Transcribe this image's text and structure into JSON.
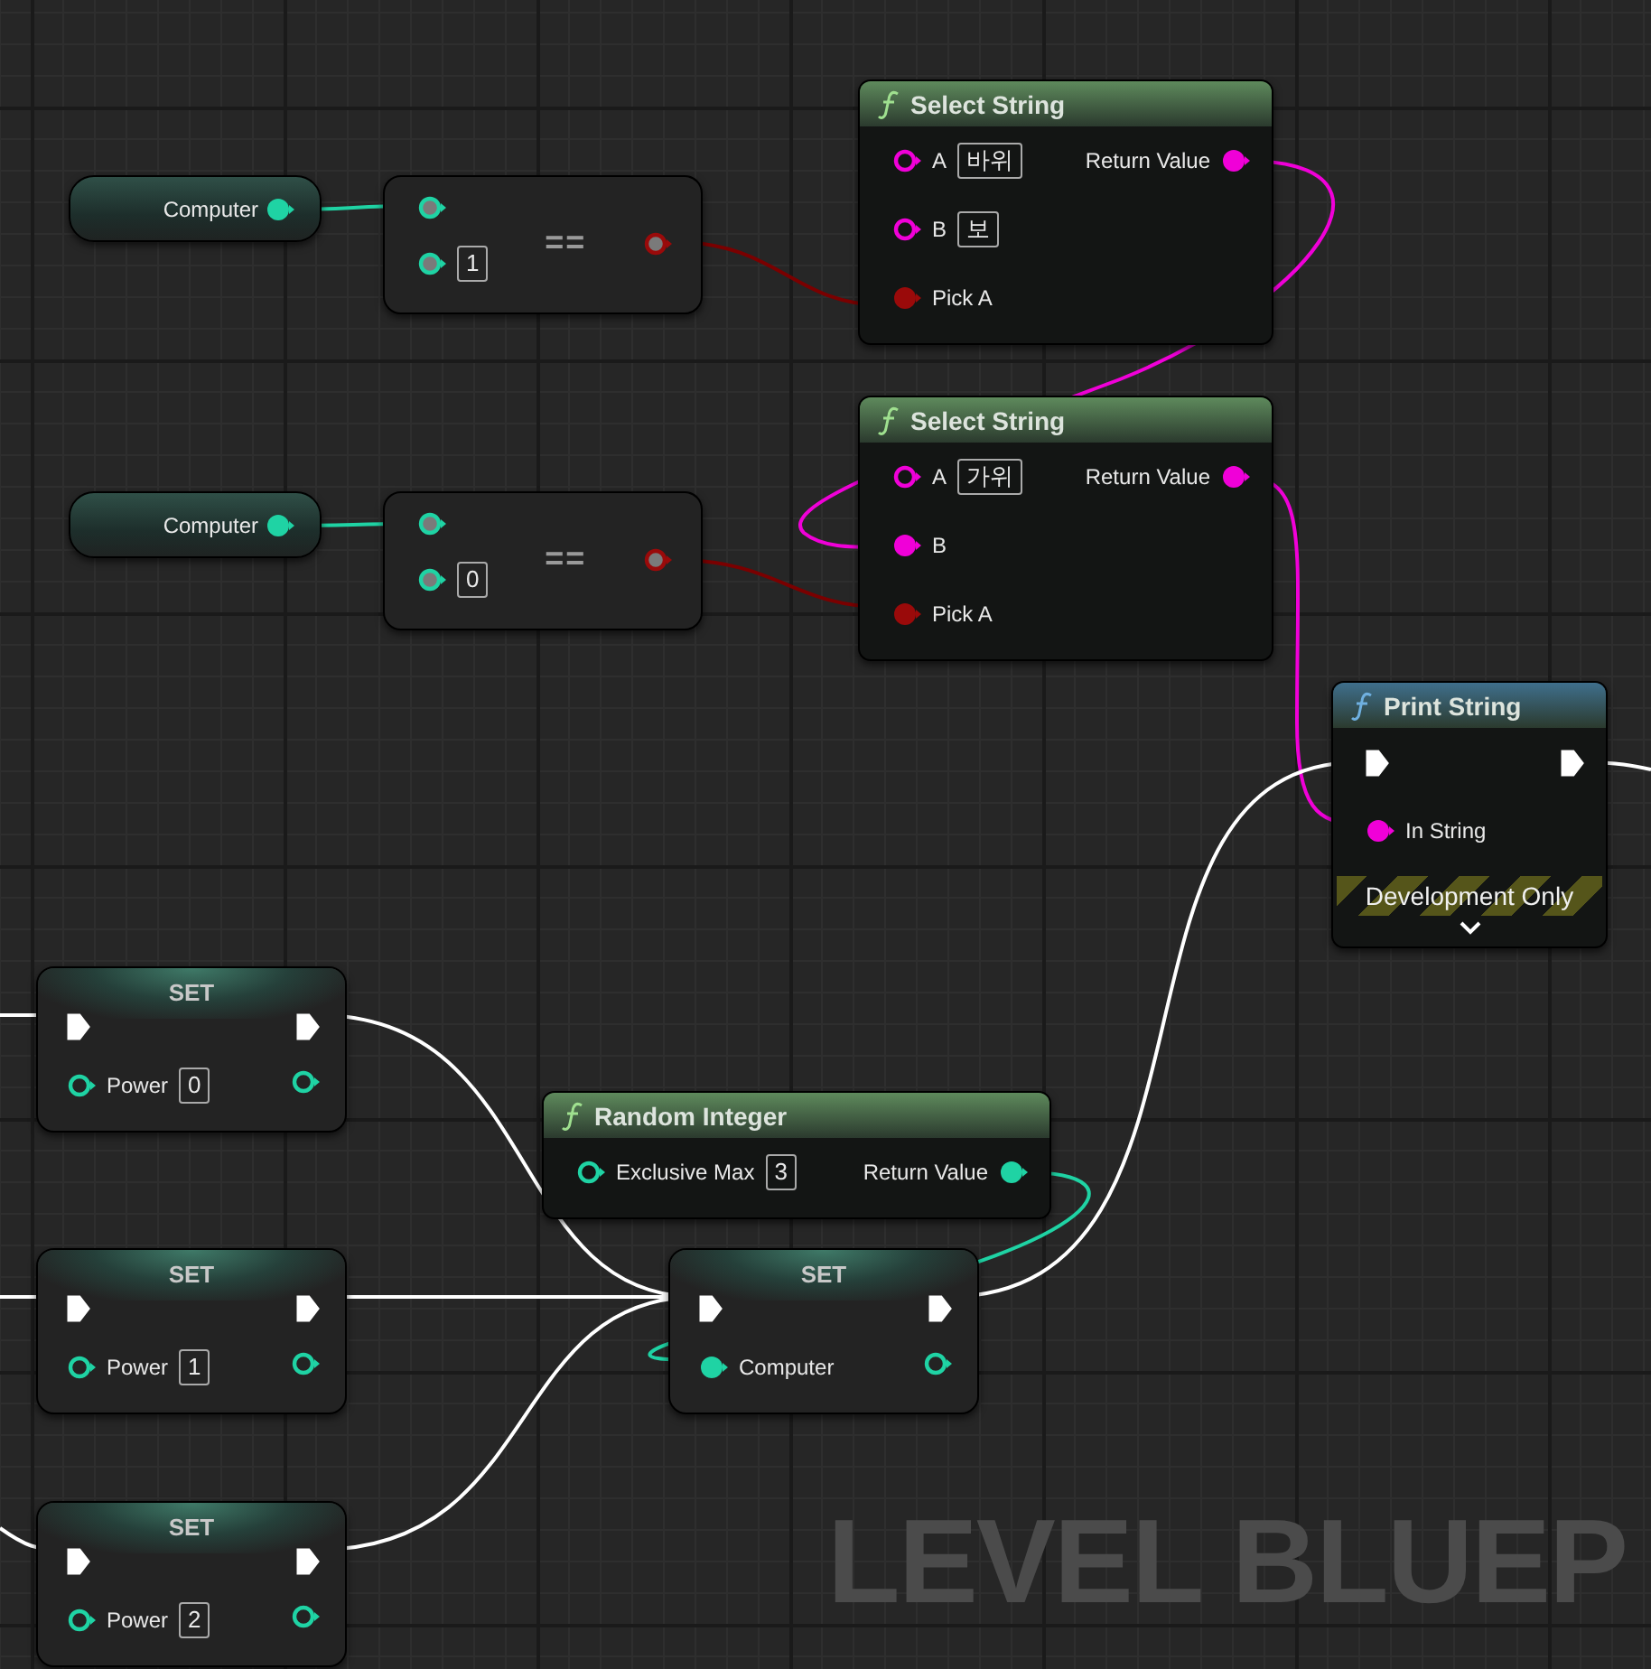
{
  "graph": {
    "watermark": "LEVEL BLUEP"
  },
  "nodes": [
    {
      "kind": "getter",
      "outputs": [
        {
          "kind": "int",
          "label": "Computer",
          "connected": true
        }
      ]
    },
    {
      "kind": "compare",
      "operator": "==",
      "inputs": [
        {
          "kind": "int"
        },
        {
          "kind": "int",
          "value": "1"
        }
      ],
      "outputs": [
        {
          "kind": "bool"
        }
      ]
    },
    {
      "kind": "getter",
      "outputs": [
        {
          "kind": "int",
          "label": "Computer",
          "connected": true
        }
      ]
    },
    {
      "kind": "compare",
      "operator": "==",
      "inputs": [
        {
          "kind": "int"
        },
        {
          "kind": "int",
          "value": "0"
        }
      ],
      "outputs": [
        {
          "kind": "bool"
        }
      ]
    },
    {
      "kind": "function",
      "title": "Select String",
      "color": "#5e8a5c",
      "inputs": [
        {
          "kind": "string",
          "label": "A",
          "value": "바위",
          "connected": false
        },
        {
          "kind": "string",
          "label": "B",
          "value": "보",
          "connected": false
        },
        {
          "kind": "bool",
          "label": "Pick A",
          "connected": true
        }
      ],
      "outputs": [
        {
          "kind": "string",
          "label": "Return Value",
          "connected": true
        }
      ]
    },
    {
      "kind": "function",
      "title": "Select String",
      "color": "#5e8a5c",
      "inputs": [
        {
          "kind": "string",
          "label": "A",
          "value": "가위",
          "connected": false
        },
        {
          "kind": "string",
          "label": "B",
          "connected": true
        },
        {
          "kind": "bool",
          "label": "Pick A",
          "connected": true
        }
      ],
      "outputs": [
        {
          "kind": "string",
          "label": "Return Value",
          "connected": true
        }
      ]
    },
    {
      "kind": "function",
      "title": "Print String",
      "color": "#3f6f8c",
      "inputs": [
        {
          "kind": "exec",
          "connected": true
        },
        {
          "kind": "string",
          "label": "In String",
          "connected": true
        }
      ],
      "outputs": [
        {
          "kind": "exec",
          "connected": true
        }
      ],
      "banner": "Development Only",
      "advanced_expanded": false
    },
    {
      "kind": "set",
      "title": "SET",
      "inputs": [
        {
          "kind": "exec",
          "connected": true
        },
        {
          "kind": "int",
          "label": "Power",
          "value": "0",
          "connected": false
        }
      ],
      "outputs": [
        {
          "kind": "exec",
          "connected": true
        },
        {
          "kind": "int",
          "connected": false
        }
      ]
    },
    {
      "kind": "function",
      "title": "Random Integer",
      "color": "#5e8a5c",
      "inputs": [
        {
          "kind": "int",
          "label": "Exclusive Max",
          "value": "3",
          "connected": false
        }
      ],
      "outputs": [
        {
          "kind": "int",
          "label": "Return Value",
          "connected": true
        }
      ]
    },
    {
      "kind": "set",
      "title": "SET",
      "inputs": [
        {
          "kind": "exec",
          "connected": true
        },
        {
          "kind": "int",
          "label": "Power",
          "value": "1",
          "connected": false
        }
      ],
      "outputs": [
        {
          "kind": "exec",
          "connected": true
        },
        {
          "kind": "int",
          "connected": false
        }
      ]
    },
    {
      "kind": "set",
      "title": "SET",
      "inputs": [
        {
          "kind": "exec",
          "connected": true
        },
        {
          "kind": "int",
          "label": "Computer",
          "connected": true
        }
      ],
      "outputs": [
        {
          "kind": "exec",
          "connected": true
        },
        {
          "kind": "int",
          "connected": false
        }
      ]
    },
    {
      "kind": "set",
      "title": "SET",
      "inputs": [
        {
          "kind": "exec",
          "connected": true
        },
        {
          "kind": "int",
          "label": "Power",
          "value": "2",
          "connected": false
        }
      ],
      "outputs": [
        {
          "kind": "exec",
          "connected": true
        },
        {
          "kind": "int",
          "connected": false
        }
      ]
    }
  ]
}
